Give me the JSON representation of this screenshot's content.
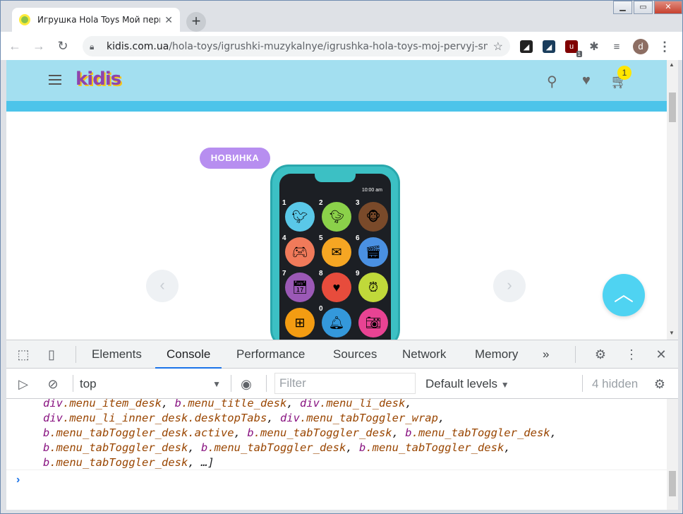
{
  "browser": {
    "tab_title": "Игрушка Hola Toys Мой первый смартфон",
    "tab_close": "✕",
    "new_tab": "+",
    "url_host": "kidis.com.ua",
    "url_path": "/hola-toys/igrushki-muzykalnye/igrushka-hola-toys-moj-pervyj-smartfo...",
    "window_controls": [
      "▁",
      "▭",
      "✕"
    ]
  },
  "extensions": {
    "ublock_badge": "1",
    "profile_initial": "d"
  },
  "site": {
    "logo": "kidis",
    "cart_count": "1",
    "badge_new": "НОВИНКА",
    "phone_time": "10:00 am"
  },
  "phone_apps": [
    {
      "num": "1",
      "icon": "bird-icon",
      "color": "#5ac8e8"
    },
    {
      "num": "2",
      "icon": "duck-icon",
      "color": "#8bd14a"
    },
    {
      "num": "3",
      "icon": "monkey-icon",
      "color": "#7a4a2a"
    },
    {
      "num": "4",
      "icon": "gamepad-icon",
      "color": "#f07a5a"
    },
    {
      "num": "5",
      "icon": "chat-icon",
      "color": "#f5a623"
    },
    {
      "num": "6",
      "icon": "clapper-icon",
      "color": "#4a90e2"
    },
    {
      "num": "7",
      "icon": "calendar-icon",
      "color": "#9b59b6"
    },
    {
      "num": "8",
      "icon": "heartbeat-icon",
      "color": "#e74c3c"
    },
    {
      "num": "9",
      "icon": "alarm-icon",
      "color": "#c0d93a"
    },
    {
      "num": "",
      "icon": "calculator-icon",
      "color": "#f39c12"
    },
    {
      "num": "0",
      "icon": "bell-icon",
      "color": "#3498db"
    },
    {
      "num": "",
      "icon": "camera-icon",
      "color": "#e84393"
    }
  ],
  "devtools": {
    "tabs": [
      "Elements",
      "Console",
      "Performance",
      "Sources",
      "Network",
      "Memory"
    ],
    "active_tab": "Console",
    "more": "»",
    "context": "top",
    "filter_placeholder": "Filter",
    "levels": "Default levels",
    "hidden": "4 hidden",
    "console_lines": [
      [
        [
          "div",
          ".menu_item_desk"
        ],
        [
          "b",
          ".menu_title_desk"
        ],
        [
          "div",
          ".menu_li_desk"
        ]
      ],
      [
        [
          "div",
          ".menu_li_inner_desk.desktopTabs"
        ],
        [
          "div",
          ".menu_tabToggler_wrap"
        ]
      ],
      [
        [
          "b",
          ".menu_tabToggler_desk.active"
        ],
        [
          "b",
          ".menu_tabToggler_desk"
        ],
        [
          "b",
          ".menu_tabToggler_desk"
        ]
      ],
      [
        [
          "b",
          ".menu_tabToggler_desk"
        ],
        [
          "b",
          ".menu_tabToggler_desk"
        ],
        [
          "b",
          ".menu_tabToggler_desk"
        ]
      ],
      [
        [
          "b",
          ".menu_tabToggler_desk"
        ]
      ]
    ],
    "console_tail": "…]",
    "prompt": "›"
  }
}
